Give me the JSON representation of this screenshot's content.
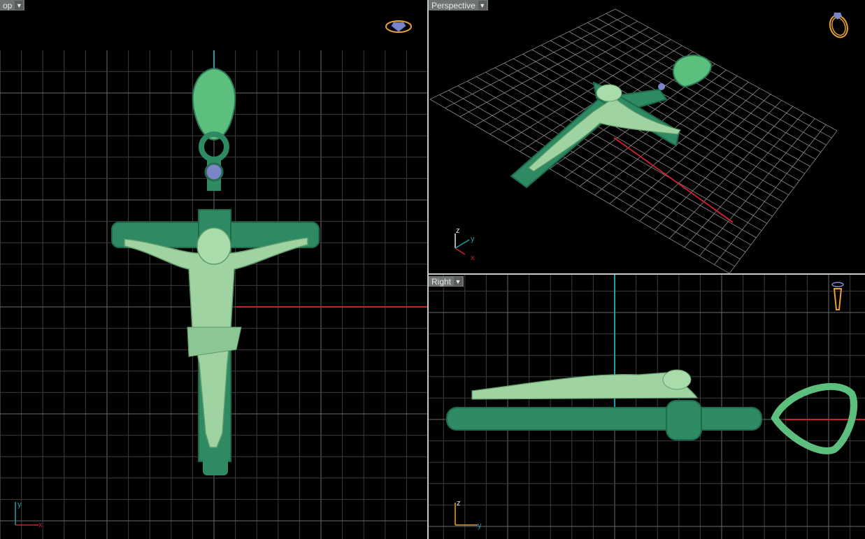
{
  "viewports": {
    "top": {
      "label": "op",
      "axis_labels": {
        "x": "x",
        "y": "y"
      }
    },
    "perspective": {
      "label": "Perspective",
      "axis_labels": {
        "x": "x",
        "y": "y",
        "z": "z"
      }
    },
    "right": {
      "label": "Right",
      "axis_labels": {
        "y": "y",
        "z": "z"
      }
    }
  },
  "colors": {
    "grid": "#3c3c3c",
    "grid_major": "#6a6a6a",
    "axis_x": "#c8202c",
    "axis_y": "#1aa0a8",
    "model_dark": "#2d8a62",
    "model_light": "#9fd4a2",
    "gem": "#7a86c8",
    "gumball_orange": "#e7a235"
  }
}
